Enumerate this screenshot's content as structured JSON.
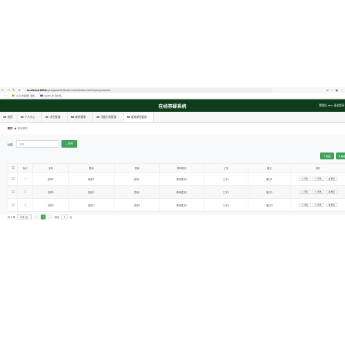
{
  "browser": {
    "url_host": "localhost:8080",
    "url_path": "/springboot0k52/admin/dist/index.html#/yonghufankui",
    "bookmarks": [
      "【CSDN调研】调研...",
      "Expert-tfr 单元化..."
    ]
  },
  "header": {
    "title": "在线答疑系统",
    "user": "管理员 abo",
    "logout": "退出登录"
  },
  "menu": {
    "items": [
      {
        "label": "首页",
        "icon": "home-icon",
        "caret": false,
        "active": false
      },
      {
        "label": "个人中心",
        "icon": "user-icon",
        "caret": true,
        "active": false
      },
      {
        "label": "学生管理",
        "icon": "student-icon",
        "caret": true,
        "active": false
      },
      {
        "label": "教师管理",
        "icon": "teacher-icon",
        "caret": true,
        "active": false
      },
      {
        "label": "问题分类管理",
        "icon": "category-icon",
        "caret": true,
        "active": false
      },
      {
        "label": "疑难解答管理",
        "icon": "answer-icon",
        "caret": true,
        "active": true
      }
    ]
  },
  "breadcrumb": {
    "home": "首页",
    "current": "疑难解答"
  },
  "search": {
    "label": "标题",
    "placeholder": "标题",
    "button": "查询"
  },
  "actions": {
    "add": "新增",
    "delete": "删除"
  },
  "table": {
    "headers": [
      "索引",
      "名称",
      "题目",
      "答案",
      "教师姓名",
      "工号",
      "备注",
      "操作"
    ],
    "rows": [
      {
        "index": "1",
        "name": "名称1",
        "question": "题目1",
        "answer": "答案1",
        "teacher": "教师姓名1",
        "job_no": "工号1",
        "remark": "备注1"
      },
      {
        "index": "2",
        "name": "名称2",
        "question": "题目2",
        "answer": "答案2",
        "teacher": "教师姓名2",
        "job_no": "工号2",
        "remark": "备注2"
      },
      {
        "index": "3",
        "name": "名称3",
        "question": "题目3",
        "answer": "答案3",
        "teacher": "教师姓名3",
        "job_no": "工号3",
        "remark": "备注3"
      }
    ],
    "row_actions": [
      "详情",
      "修改",
      "删除"
    ]
  },
  "pagination": {
    "total": "共 3 条",
    "page_size": "10条/页",
    "current_page": "1",
    "goto_label": "前往",
    "goto_value": "1",
    "page_suffix": "页"
  },
  "colors": {
    "header_bg": "#0f3d1c",
    "accent": "#43a35a",
    "heart": "#e2353d"
  }
}
